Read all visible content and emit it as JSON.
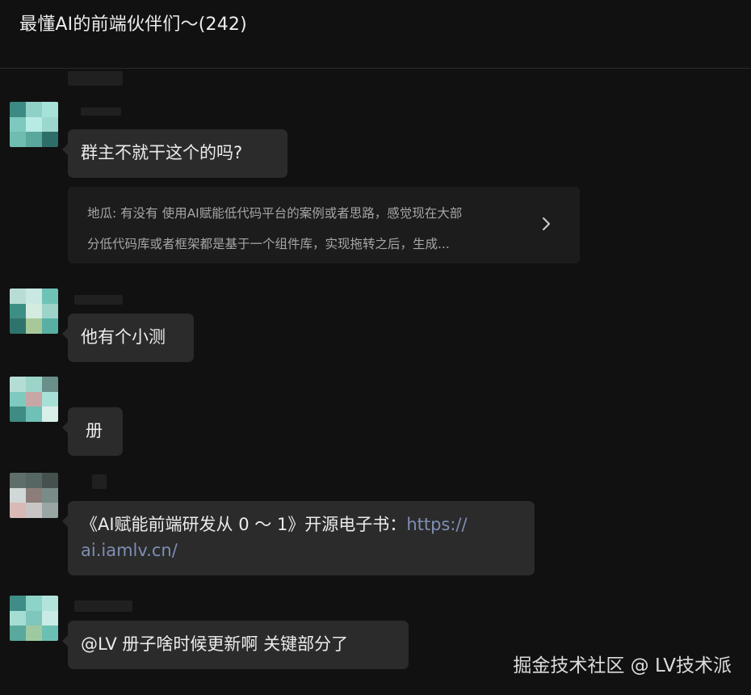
{
  "header": {
    "title": "最懂AI的前端伙伴们～(242)"
  },
  "messages": [
    {
      "text": "群主不就干这个的吗?"
    },
    {
      "text": "他有个小测"
    },
    {
      "text": "册"
    },
    {
      "text_prefix": "《AI赋能前端研发从 0 ～ 1》开源电子书：",
      "link_line1": "https://",
      "link_line2": "ai.iamlv.cn/"
    },
    {
      "text": "@LV  册子啥时候更新啊 关键部分了"
    }
  ],
  "quote": {
    "line1": "地瓜: 有没有 使用AI赋能低代码平台的案例或者思路，感觉现在大部",
    "line2": "分低代码库或者框架都是基于一个组件库，实现拖转之后，生成...",
    "icon": "chevron-right-icon"
  },
  "watermark": "掘金技术社区 @ LV技术派",
  "colors": {
    "background": "#111111",
    "bubble": "#2b2b2b",
    "quote_bg": "#1c1c1c",
    "link": "#7e8fb3"
  }
}
